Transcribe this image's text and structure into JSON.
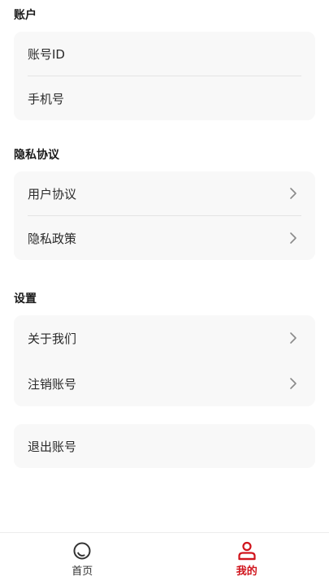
{
  "sections": {
    "account": {
      "title": "账户",
      "items": [
        "账号ID",
        "手机号"
      ]
    },
    "privacy": {
      "title": "隐私协议",
      "items": [
        "用户协议",
        "隐私政策"
      ]
    },
    "settings": {
      "title": "设置",
      "items": [
        "关于我们",
        "注销账号"
      ]
    }
  },
  "logout": {
    "label": "退出账号"
  },
  "tabbar": {
    "tabs": [
      {
        "label": "首页",
        "icon": "home-icon",
        "active": false
      },
      {
        "label": "我的",
        "icon": "profile-icon",
        "active": true
      }
    ]
  },
  "colors": {
    "accent": "#d0141c",
    "card_bg": "#f8f8f8",
    "divider": "#e4e4e4",
    "chevron": "#8a8a8a"
  }
}
